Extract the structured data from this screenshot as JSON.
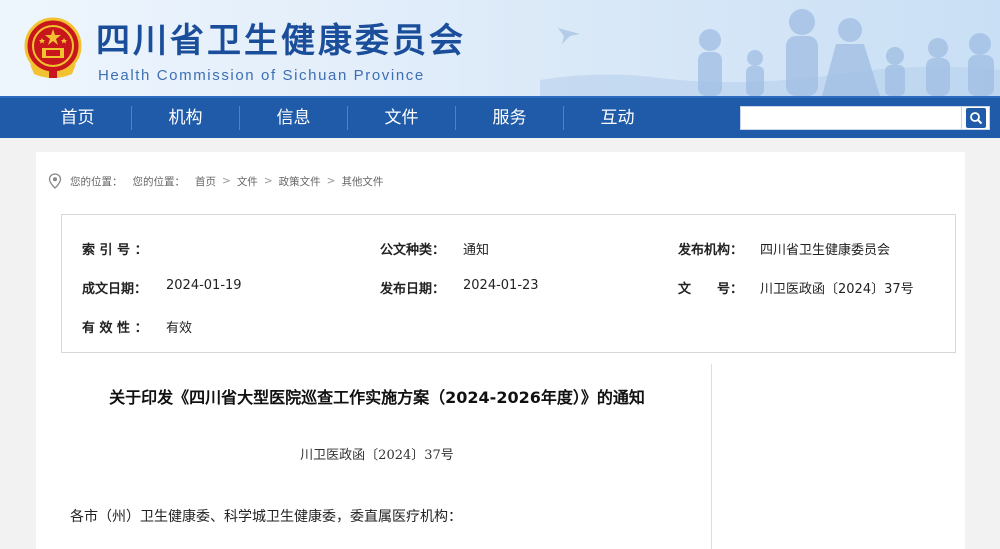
{
  "header": {
    "title": "四川省卫生健康委员会",
    "subtitle": "Health Commission of Sichuan Province"
  },
  "nav": {
    "items": [
      "首页",
      "机构",
      "信息",
      "文件",
      "服务",
      "互动"
    ],
    "search_placeholder": ""
  },
  "breadcrumb": {
    "label1": "您的位置：",
    "label2": "您的位置：",
    "items": [
      "首页",
      "文件",
      "政策文件",
      "其他文件"
    ],
    "separator": ">"
  },
  "meta": {
    "index_label": "索 引 号 ：",
    "index_value": "",
    "type_label": "公文种类：",
    "type_value": "通知",
    "org_label": "发布机构：",
    "org_value": "四川省卫生健康委员会",
    "created_label": "成文日期：",
    "created_value": "2024-01-19",
    "published_label": "发布日期：",
    "published_value": "2024-01-23",
    "docno_label": "文　　号：",
    "docno_value": "川卫医政函〔2024〕37号",
    "validity_label": "有 效 性 ：",
    "validity_value": "有效"
  },
  "document": {
    "title": "关于印发《四川省大型医院巡查工作实施方案（2024-2026年度）》的通知",
    "number": "川卫医政函〔2024〕37号",
    "greeting": "各市（州）卫生健康委、科学城卫生健康委，委直属医疗机构："
  },
  "colors": {
    "brand_blue": "#1b4e9a",
    "nav_blue": "#1f5ba8",
    "emblem_red": "#c8161d",
    "emblem_gold": "#f2c230"
  }
}
